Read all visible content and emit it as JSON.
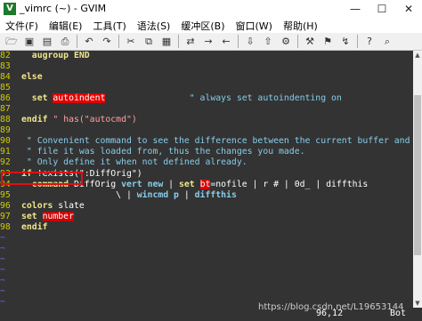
{
  "window": {
    "icon": "vim-icon",
    "title": "_vimrc (~) - GVIM",
    "minimize": "—",
    "maximize": "☐",
    "close": "✕"
  },
  "menu": [
    "文件(F)",
    "编辑(E)",
    "工具(T)",
    "语法(S)",
    "缓冲区(B)",
    "窗口(W)",
    "帮助(H)"
  ],
  "toolbar": [
    "open-file-icon",
    "save-icon",
    "save-all-icon",
    "print-icon",
    "undo-icon",
    "redo-icon",
    "cut-icon",
    "copy-icon",
    "paste-icon",
    "find-replace-icon",
    "find-next-icon",
    "find-prev-icon",
    "load-session-icon",
    "save-session-icon",
    "run-script-icon",
    "make-icon",
    "build-tags-icon",
    "jump-tag-icon",
    "help-icon",
    "find-help-icon"
  ],
  "editor": {
    "lines": [
      {
        "n": "82",
        "parts": [
          [
            "  augroup END",
            "kw"
          ]
        ]
      },
      {
        "n": "83",
        "parts": []
      },
      {
        "n": "84",
        "parts": [
          [
            "else",
            "kw"
          ]
        ]
      },
      {
        "n": "85",
        "parts": []
      },
      {
        "n": "86",
        "parts": [
          [
            "  set ",
            "kw"
          ],
          [
            "autoindent",
            "hl"
          ],
          [
            "                \" always set autoindenting on",
            "cm"
          ]
        ]
      },
      {
        "n": "87",
        "parts": []
      },
      {
        "n": "88",
        "parts": [
          [
            "endif",
            "kw"
          ],
          [
            " \" has(\"autocmd\")",
            "str"
          ]
        ]
      },
      {
        "n": "89",
        "parts": []
      },
      {
        "n": "90",
        "parts": [
          [
            " \" Convenient command to see the difference between the current buffer and the",
            "cm"
          ]
        ]
      },
      {
        "n": "91",
        "parts": [
          [
            " \" file it was loaded from, thus the changes you made.",
            "cm"
          ]
        ]
      },
      {
        "n": "92",
        "parts": [
          [
            " \" Only define it when not defined already.",
            "cm"
          ]
        ]
      },
      {
        "n": "93",
        "parts": [
          [
            "if ",
            "kw"
          ],
          [
            "!exists(\":DiffOrig\")",
            "plain"
          ]
        ]
      },
      {
        "n": "94",
        "parts": [
          [
            "  command ",
            "kw"
          ],
          [
            "DiffOrig ",
            "plain"
          ],
          [
            "vert new",
            "kw2"
          ],
          [
            " | ",
            "plain"
          ],
          [
            "set ",
            "kw"
          ],
          [
            "bt",
            "hl"
          ],
          [
            "=nofile | r # | 0d_ | diffthis",
            "plain"
          ]
        ]
      },
      {
        "n": "95",
        "parts": [
          [
            "                  \\ | ",
            "plain"
          ],
          [
            "wincmd p",
            "kw2"
          ],
          [
            " | ",
            "plain"
          ],
          [
            "diffthis",
            "kw2"
          ]
        ]
      },
      {
        "n": "96",
        "parts": [
          [
            "colors ",
            "kw"
          ],
          [
            "slate",
            "plain"
          ]
        ]
      },
      {
        "n": "97",
        "parts": [
          [
            "set ",
            "kw"
          ],
          [
            "number",
            "err"
          ]
        ]
      },
      {
        "n": "98",
        "parts": [
          [
            "endif",
            "kw"
          ]
        ]
      }
    ],
    "tilde": "~",
    "tilde_count": 7
  },
  "status": {
    "position": "96,12",
    "scroll": "Bot"
  },
  "watermark": "https://blog.csdn.net/L19653144"
}
